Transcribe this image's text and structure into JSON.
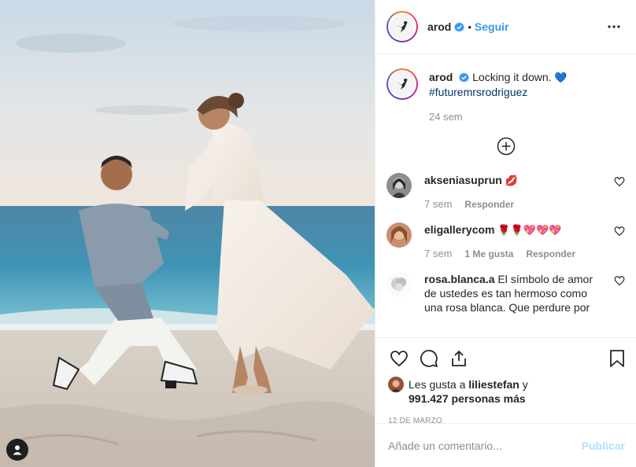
{
  "post": {
    "author": "arod",
    "follow_label": "Seguir",
    "separator": "•",
    "caption_text": "Locking it down.",
    "caption_emoji": "💙",
    "hashtag": "#futuremrsrodriguez",
    "caption_time": "24 sem"
  },
  "comments": [
    {
      "user": "akseniasuprun",
      "text": "💋",
      "time": "7 sem",
      "likes_label": "",
      "reply_label": "Responder"
    },
    {
      "user": "eligallerycom",
      "text": "🌹🌹💖💖💖",
      "time": "7 sem",
      "likes_label": "1 Me gusta",
      "reply_label": "Responder"
    },
    {
      "user": "rosa.blanca.a",
      "text": "El símbolo de amor de ustedes es tan hermoso como una rosa blanca. Que perdure por",
      "time": "",
      "likes_label": "",
      "reply_label": ""
    }
  ],
  "likes": {
    "prefix": "Les gusta a",
    "user": "liliestefan",
    "connector": "y",
    "count": "991.427",
    "suffix": "personas más"
  },
  "date": "12 DE MARZO",
  "add_comment": {
    "placeholder": "Añade un comentario...",
    "publish_label": "Publicar"
  },
  "icons": {
    "verified": "verified-badge-icon",
    "more": "more-options-icon",
    "load_more": "plus-circle-icon",
    "like": "heart-icon",
    "comment": "comment-bubble-icon",
    "share": "share-icon",
    "save": "bookmark-icon",
    "user_tags": "user-icon"
  },
  "colors": {
    "link": "#3897f0",
    "hashtag": "#003569",
    "muted": "#8e8e8e",
    "publish_disabled": "#b2dffc"
  }
}
